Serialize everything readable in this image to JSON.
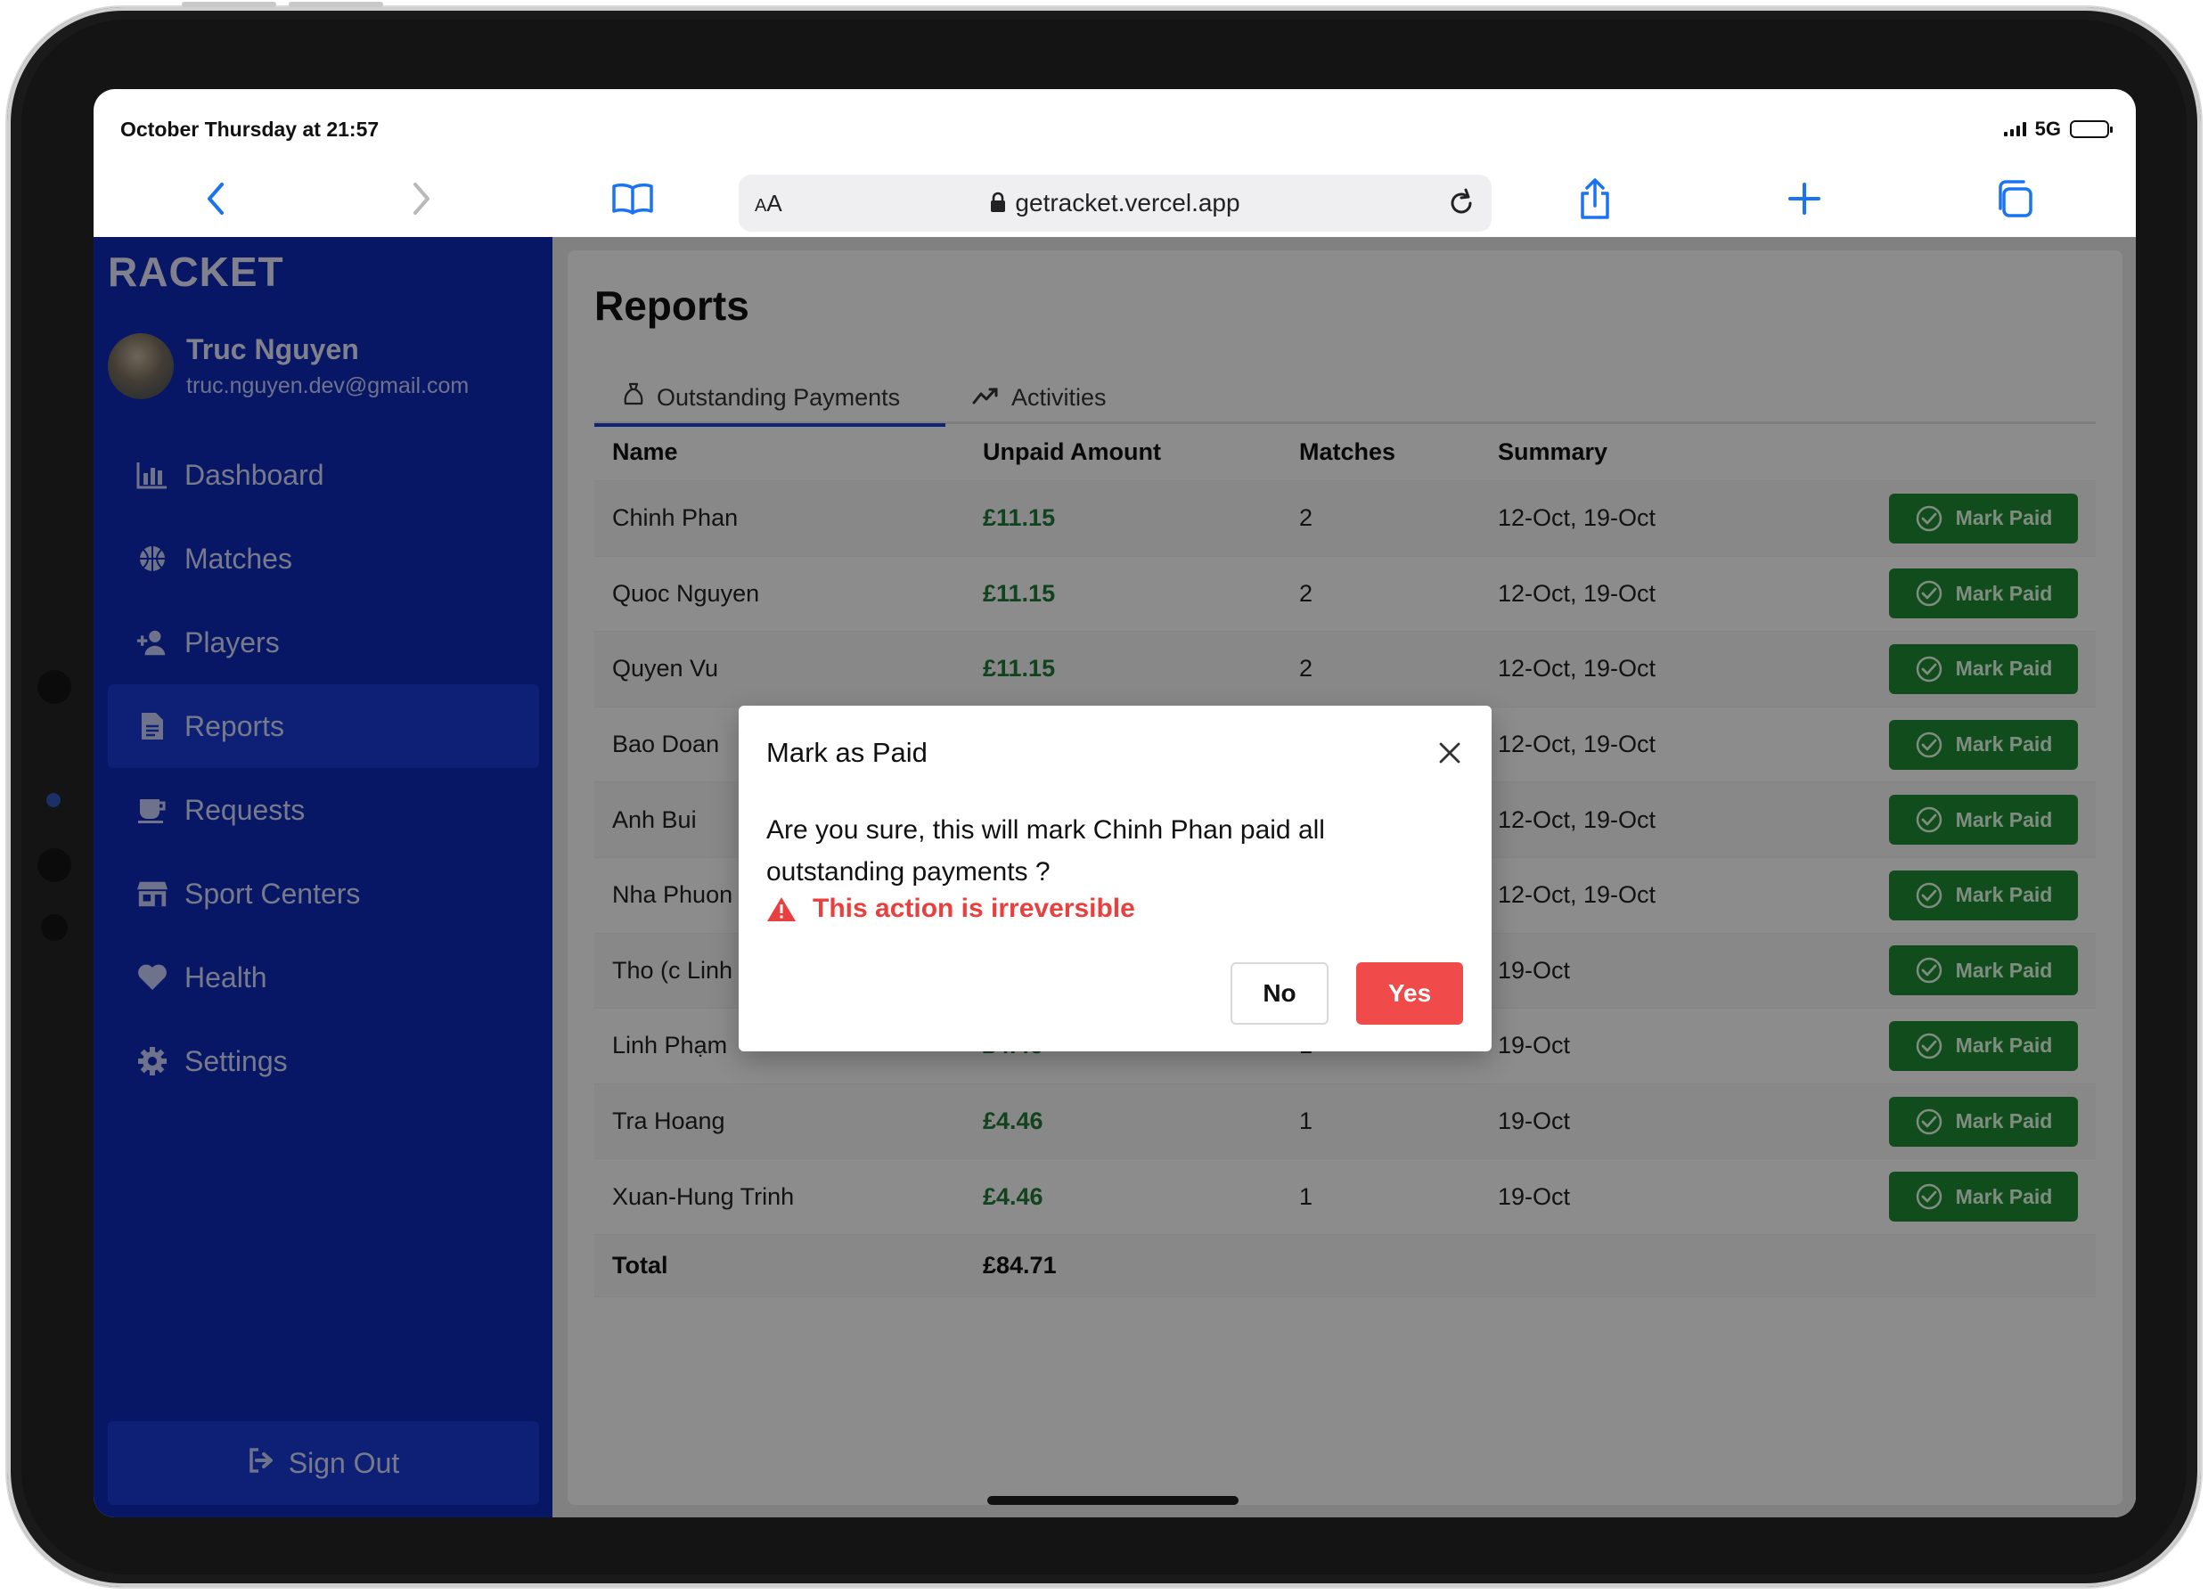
{
  "status_bar": {
    "time": "October Thursday at 21:57",
    "network": "5G"
  },
  "browser": {
    "url": "getracket.vercel.app",
    "reader_label": "AA",
    "icons": [
      "back-icon",
      "forward-icon",
      "bookmarks-icon",
      "lock-icon",
      "reload-icon",
      "share-icon",
      "new-tab-icon",
      "tabs-icon"
    ]
  },
  "sidebar": {
    "brand": "RACKET",
    "user": {
      "name": "Truc Nguyen",
      "email": "truc.nguyen.dev@gmail.com"
    },
    "items": [
      {
        "label": "Dashboard",
        "icon": "bar-chart-icon"
      },
      {
        "label": "Matches",
        "icon": "ball-icon"
      },
      {
        "label": "Players",
        "icon": "add-user-icon"
      },
      {
        "label": "Reports",
        "icon": "document-icon",
        "active": true
      },
      {
        "label": "Requests",
        "icon": "cup-icon"
      },
      {
        "label": "Sport Centers",
        "icon": "store-icon"
      },
      {
        "label": "Health",
        "icon": "heart-icon"
      },
      {
        "label": "Settings",
        "icon": "gear-icon"
      }
    ],
    "signout_label": "Sign Out"
  },
  "main": {
    "title": "Reports",
    "tabs": [
      {
        "label": "Outstanding Payments",
        "icon": "money-bag-icon",
        "active": true
      },
      {
        "label": "Activities",
        "icon": "trend-icon"
      }
    ],
    "table": {
      "headers": [
        "Name",
        "Unpaid Amount",
        "Matches",
        "Summary"
      ],
      "rows": [
        {
          "name": "Chinh Phan",
          "amount": "£11.15",
          "matches": "2",
          "summary": "12-Oct, 19-Oct"
        },
        {
          "name": "Quoc Nguyen",
          "amount": "£11.15",
          "matches": "2",
          "summary": "12-Oct, 19-Oct"
        },
        {
          "name": "Quyen Vu",
          "amount": "£11.15",
          "matches": "2",
          "summary": "12-Oct, 19-Oct"
        },
        {
          "name": "Bao Doan",
          "amount": "",
          "matches": "",
          "summary": "12-Oct, 19-Oct"
        },
        {
          "name": "Anh Bui",
          "amount": "",
          "matches": "",
          "summary": "12-Oct, 19-Oct"
        },
        {
          "name": "Nha Phuon",
          "amount": "",
          "matches": "",
          "summary": "12-Oct, 19-Oct"
        },
        {
          "name": "Tho (c Linh",
          "amount": "",
          "matches": "",
          "summary": "19-Oct"
        },
        {
          "name": "Linh Phạm",
          "amount": "£4.46",
          "matches": "1",
          "summary": "19-Oct"
        },
        {
          "name": "Tra Hoang",
          "amount": "£4.46",
          "matches": "1",
          "summary": "19-Oct"
        },
        {
          "name": "Xuan-Hung Trinh",
          "amount": "£4.46",
          "matches": "1",
          "summary": "19-Oct"
        }
      ],
      "action_label": "Mark Paid",
      "total_label": "Total",
      "total_amount": "£84.71"
    }
  },
  "modal": {
    "title": "Mark as Paid",
    "message": "Are you sure, this will mark Chinh Phan paid all outstanding payments ?",
    "warning": "This action is irreversible",
    "no_label": "No",
    "yes_label": "Yes"
  },
  "colors": {
    "sidebar": "#0d2ab8",
    "accent": "#1b3fd8",
    "success": "#1f8a34",
    "danger": "#f04a4a",
    "amount": "#1f7a3a"
  }
}
